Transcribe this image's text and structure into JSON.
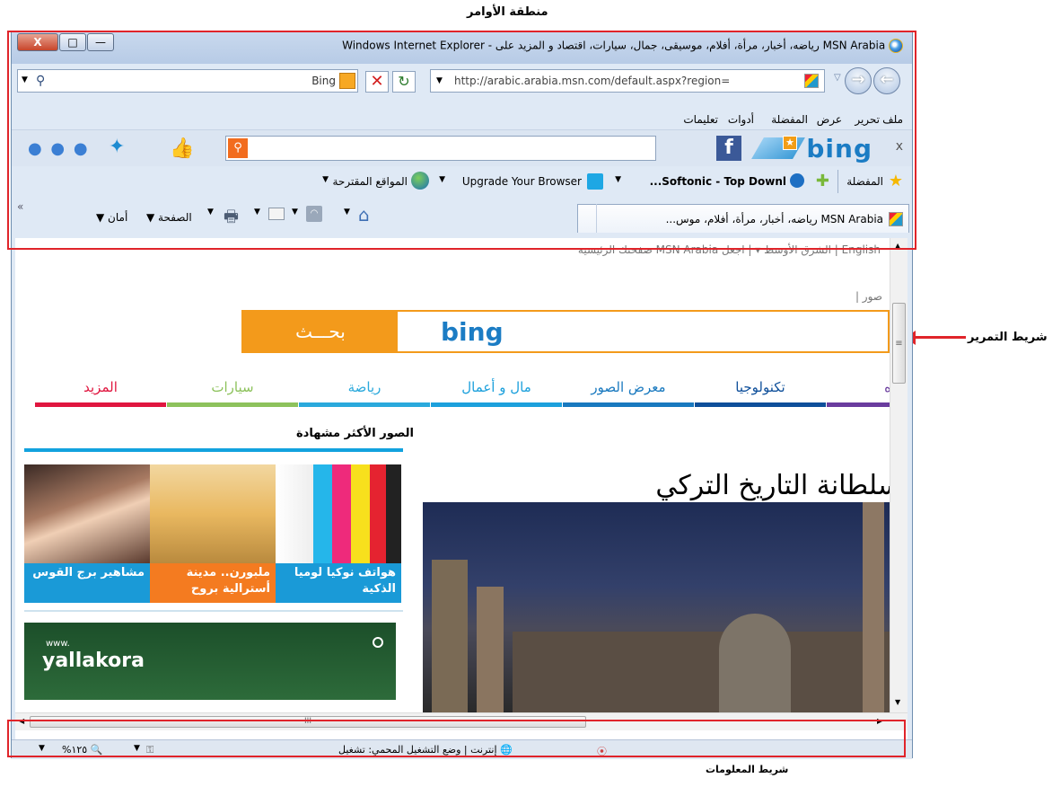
{
  "annotations": {
    "command_area": "منطقة الأوامر",
    "scrollbar": "شريط التمرير",
    "infobar": "شريط المعلومات"
  },
  "titlebar": {
    "title": "MSN Arabia رياضه، أخبار، مرأة، أفلام، موسيقى، جمال، سيارات، اقتصاد و المزيد على - Windows Internet Explorer",
    "buttons": {
      "close": "X",
      "maximize": "□",
      "minimize": "—"
    }
  },
  "address": {
    "url": "http://arabic.arabia.msn.com/default.aspx?region=",
    "search_provider": "Bing",
    "stop": "✕",
    "refresh": "↻"
  },
  "menu": [
    "ملف",
    "تحرير",
    "عرض",
    "المفضلة",
    "أدوات",
    "تعليمات"
  ],
  "bing_toolbar": {
    "close": "x",
    "logo": "bing",
    "facebook": "f",
    "dots": "● ● ●"
  },
  "favorites_bar": {
    "favorites": "المفضلة",
    "items": [
      "...Softonic - Top Downl",
      "Upgrade Your Browser",
      "المواقع المقترحة"
    ]
  },
  "command_bar": {
    "tab_title": "MSN Arabia رياضه، أخبار، مرأة، أفلام، موس...",
    "page": "الصفحة",
    "safety": "أمان",
    "chevron": "«"
  },
  "page": {
    "top_links": "English | الشرق الأوسط ▾ | اجعل MSN Arabia صفحتك الرئيسية",
    "images": "صور |",
    "bing_logo": "bing",
    "search_button": "بحـــث",
    "nav": [
      {
        "label": "المزيد",
        "color": "#e0163f"
      },
      {
        "label": "سيارات",
        "color": "#8dc25c"
      },
      {
        "label": "رياضة",
        "color": "#2aa9dc"
      },
      {
        "label": "مال و أعمال",
        "color": "#1ca0dc"
      },
      {
        "label": "معرض الصور",
        "color": "#1979bf"
      },
      {
        "label": "تكنولوجيا",
        "color": "#0e4f9a"
      },
      {
        "label": "ه",
        "color": "#6a3c9e"
      }
    ],
    "popular_title": "الصور الأكثر مشهادة",
    "tiles": [
      {
        "caption": "مشاهير برج القوس",
        "color": "#1a9ad7"
      },
      {
        "caption": "ملبورن.. مدينة أسترالية بروح",
        "color": "#f47b20"
      },
      {
        "caption": "هواتف نوكيا لوميا الذكية",
        "color": "#1a9ad7"
      }
    ],
    "ad": {
      "www": "www.",
      "logo": "yallakora"
    },
    "headline": "سلطانة التاريخ التركي"
  },
  "statusbar": {
    "zone": "إنترنت | وضع التشغيل المحمي: تشغيل",
    "zoom": "%١٢٥"
  }
}
